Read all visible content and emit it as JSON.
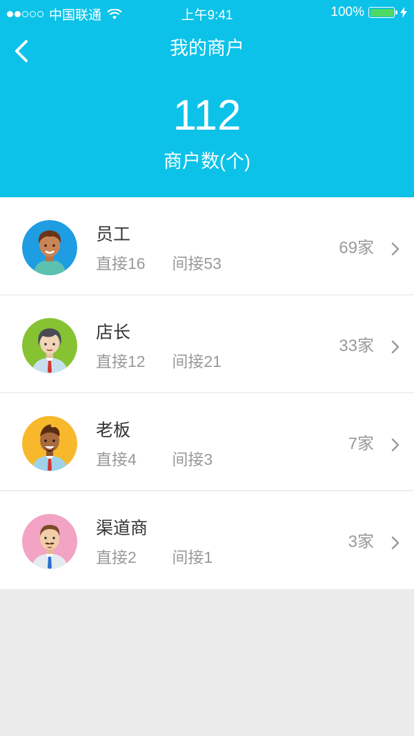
{
  "status_bar": {
    "carrier": "中国联通",
    "time": "上午9:41",
    "battery": "100%"
  },
  "nav": {
    "title": "我的商户"
  },
  "summary": {
    "count": "112",
    "label": "商户数(个)"
  },
  "colors": {
    "header_bg": "#0cc2e9",
    "battery_green": "#4cd964"
  },
  "rows": [
    {
      "name": "员工",
      "direct": "直接16",
      "indirect": "间接53",
      "count": "69家",
      "avatar_bg": "#1e9de3",
      "icon": "employee-avatar-icon"
    },
    {
      "name": "店长",
      "direct": "直接12",
      "indirect": "间接21",
      "count": "33家",
      "avatar_bg": "#86c232",
      "icon": "store-manager-avatar-icon"
    },
    {
      "name": "老板",
      "direct": "直接4",
      "indirect": "间接3",
      "count": "7家",
      "avatar_bg": "#f8b82b",
      "icon": "boss-avatar-icon"
    },
    {
      "name": "渠道商",
      "direct": "直接2",
      "indirect": "间接1",
      "count": "3家",
      "avatar_bg": "#f3a3c4",
      "icon": "channel-partner-avatar-icon"
    }
  ]
}
